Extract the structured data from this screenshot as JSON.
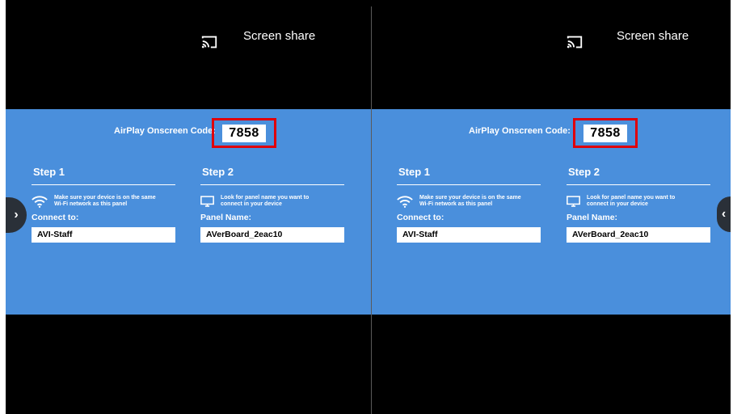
{
  "panels": [
    {
      "screen_share_label": "Screen share",
      "airplay_code_label": "AirPlay Onscreen Code:",
      "airplay_code": "7858",
      "step1": {
        "title": "Step 1",
        "description_line1": "Make sure your device is on the same",
        "description_line2": "Wi-Fi network as this panel",
        "field_label": "Connect to:",
        "field_value": "AVI-Staff"
      },
      "step2": {
        "title": "Step 2",
        "description_line1": "Look for panel name you want to",
        "description_line2": "connect in your device",
        "field_label": "Panel Name:",
        "field_value": "AVerBoard_2eac10"
      }
    },
    {
      "screen_share_label": "Screen share",
      "airplay_code_label": "AirPlay Onscreen Code:",
      "airplay_code": "7858",
      "step1": {
        "title": "Step 1",
        "description_line1": "Make sure your device is on the same",
        "description_line2": "Wi-Fi network as this panel",
        "field_label": "Connect to:",
        "field_value": "AVI-Staff"
      },
      "step2": {
        "title": "Step 2",
        "description_line1": "Look for panel name you want to",
        "description_line2": "connect in your device",
        "field_label": "Panel Name:",
        "field_value": "AVerBoard_2eac10"
      }
    }
  ],
  "nav": {
    "left_chevron": "›",
    "right_chevron": "‹"
  },
  "icons": [
    "cast-icon",
    "wifi-icon",
    "monitor-icon",
    "chevron-right-icon",
    "chevron-left-icon"
  ],
  "colors": {
    "background": "#000000",
    "panel_blue": "#4a8fdc",
    "highlight_red": "#e0000a"
  }
}
